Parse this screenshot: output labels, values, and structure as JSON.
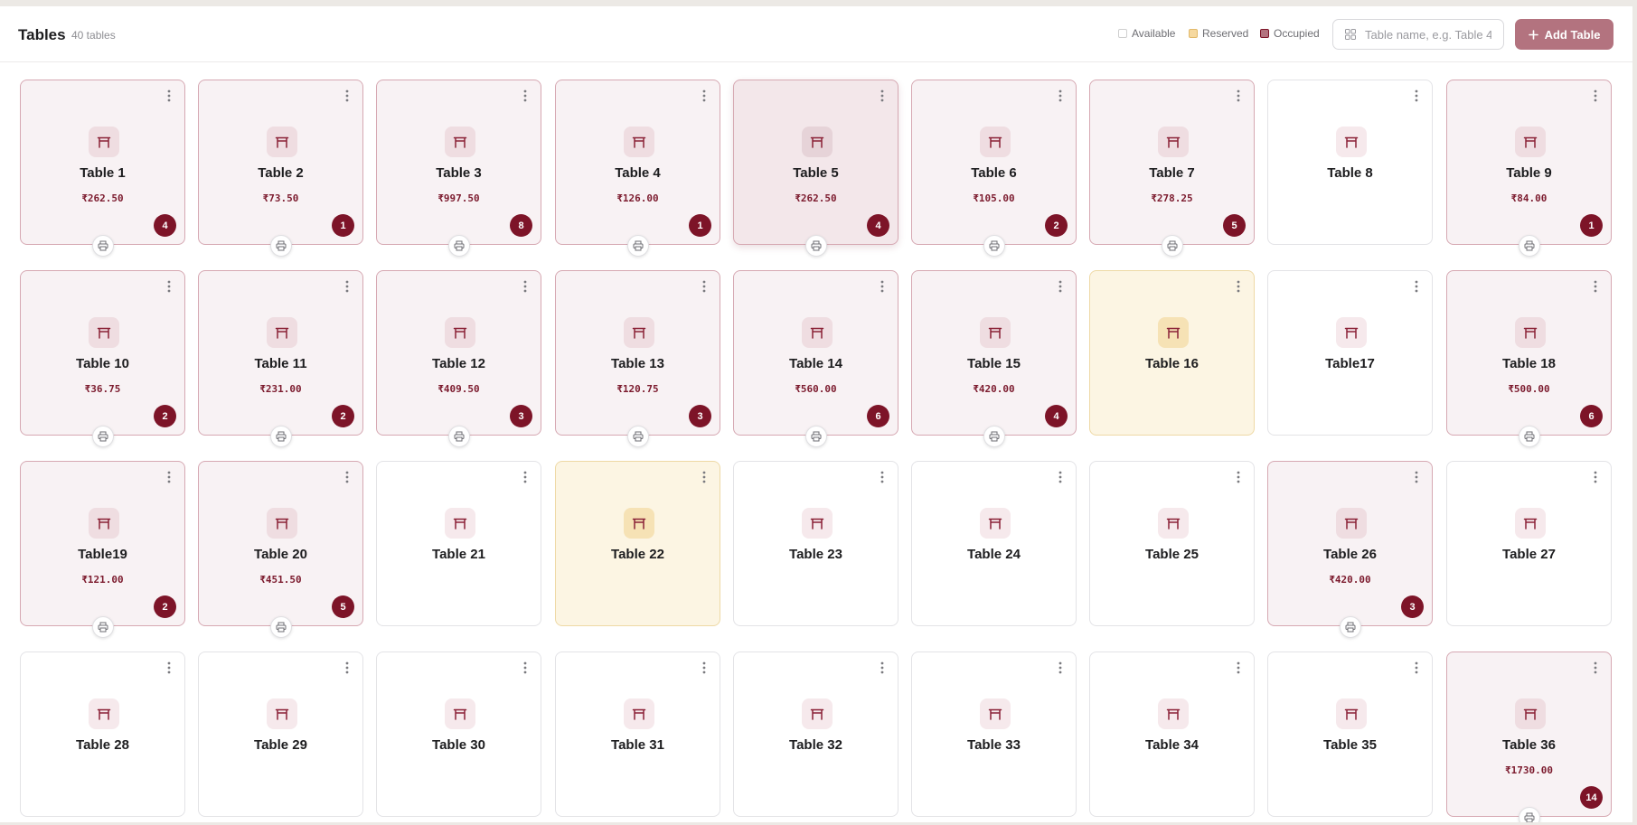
{
  "header": {
    "title": "Tables",
    "count": "40 tables",
    "legend": {
      "available": "Available",
      "reserved": "Reserved",
      "occupied": "Occupied"
    },
    "search_placeholder": "Table name, e.g. Table 4",
    "add_label": "Add Table"
  },
  "colors": {
    "brand": "#7d1428",
    "button": "#b3737f",
    "occupied_bg": "#f8f2f4",
    "reserved_bg": "#fcf5e3",
    "available_bg": "#ffffff"
  },
  "icons": {
    "table": "table-icon",
    "menu": "kebab-menu-icon",
    "print": "printer-icon",
    "grid": "grid-icon",
    "plus": "plus-icon"
  },
  "tables": [
    {
      "name": "Table 1",
      "status": "occupied",
      "amount": "₹262.50",
      "count": "4"
    },
    {
      "name": "Table 2",
      "status": "occupied",
      "amount": "₹73.50",
      "count": "1"
    },
    {
      "name": "Table 3",
      "status": "occupied",
      "amount": "₹997.50",
      "count": "8"
    },
    {
      "name": "Table 4",
      "status": "occupied",
      "amount": "₹126.00",
      "count": "1"
    },
    {
      "name": "Table 5",
      "status": "occupied",
      "amount": "₹262.50",
      "count": "4",
      "highlight": true
    },
    {
      "name": "Table 6",
      "status": "occupied",
      "amount": "₹105.00",
      "count": "2"
    },
    {
      "name": "Table 7",
      "status": "occupied",
      "amount": "₹278.25",
      "count": "5"
    },
    {
      "name": "Table 8",
      "status": "available"
    },
    {
      "name": "Table 9",
      "status": "occupied",
      "amount": "₹84.00",
      "count": "1"
    },
    {
      "name": "Table 10",
      "status": "occupied",
      "amount": "₹36.75",
      "count": "2"
    },
    {
      "name": "Table 11",
      "status": "occupied",
      "amount": "₹231.00",
      "count": "2"
    },
    {
      "name": "Table 12",
      "status": "occupied",
      "amount": "₹409.50",
      "count": "3"
    },
    {
      "name": "Table 13",
      "status": "occupied",
      "amount": "₹120.75",
      "count": "3"
    },
    {
      "name": "Table 14",
      "status": "occupied",
      "amount": "₹560.00",
      "count": "6"
    },
    {
      "name": "Table 15",
      "status": "occupied",
      "amount": "₹420.00",
      "count": "4"
    },
    {
      "name": "Table 16",
      "status": "reserved"
    },
    {
      "name": "Table17",
      "status": "available"
    },
    {
      "name": "Table 18",
      "status": "occupied",
      "amount": "₹500.00",
      "count": "6"
    },
    {
      "name": "Table19",
      "status": "occupied",
      "amount": "₹121.00",
      "count": "2"
    },
    {
      "name": "Table 20",
      "status": "occupied",
      "amount": "₹451.50",
      "count": "5"
    },
    {
      "name": "Table 21",
      "status": "available"
    },
    {
      "name": "Table 22",
      "status": "reserved"
    },
    {
      "name": "Table 23",
      "status": "available"
    },
    {
      "name": "Table 24",
      "status": "available"
    },
    {
      "name": "Table 25",
      "status": "available"
    },
    {
      "name": "Table 26",
      "status": "occupied",
      "amount": "₹420.00",
      "count": "3"
    },
    {
      "name": "Table 27",
      "status": "available"
    },
    {
      "name": "Table 28",
      "status": "available"
    },
    {
      "name": "Table 29",
      "status": "available"
    },
    {
      "name": "Table 30",
      "status": "available"
    },
    {
      "name": "Table 31",
      "status": "available"
    },
    {
      "name": "Table 32",
      "status": "available"
    },
    {
      "name": "Table 33",
      "status": "available"
    },
    {
      "name": "Table 34",
      "status": "available"
    },
    {
      "name": "Table 35",
      "status": "available"
    },
    {
      "name": "Table 36",
      "status": "occupied",
      "amount": "₹1730.00",
      "count": "14"
    }
  ]
}
